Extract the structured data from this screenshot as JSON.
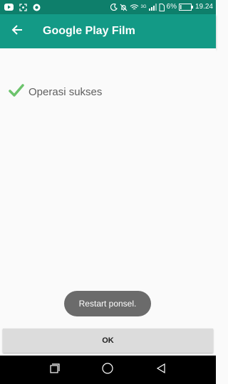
{
  "status_bar": {
    "battery": "6%",
    "time": "19.24",
    "network_label": "3G",
    "icons_left": [
      "youtube-icon",
      "screenshot-icon",
      "chrome-icon"
    ],
    "icons_right": [
      "moon-icon",
      "mute-icon",
      "wifi-icon",
      "signal-icon",
      "sim-icon",
      "battery-icon"
    ]
  },
  "app_bar": {
    "title": "Google Play Film",
    "back_icon": "arrow-back-icon"
  },
  "content": {
    "result_icon": "check-icon",
    "result_text": "Operasi sukses"
  },
  "toast": {
    "text": "Restart ponsel."
  },
  "footer": {
    "ok_label": "OK"
  },
  "nav_bar": {
    "icons": [
      "recent-apps-icon",
      "home-icon",
      "back-icon"
    ]
  },
  "colors": {
    "status_bar": "#0e7f6b",
    "app_bar": "#139a86",
    "check": "#6cc36c"
  }
}
